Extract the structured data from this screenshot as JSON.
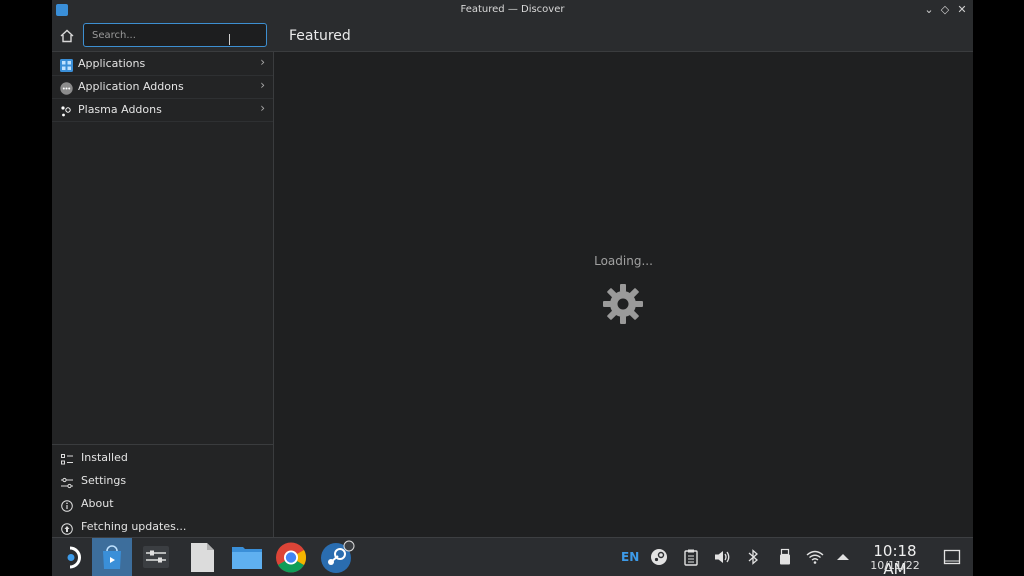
{
  "window": {
    "title": "Featured — Discover",
    "buttons": [
      "minimize",
      "maximize",
      "close"
    ]
  },
  "header": {
    "search_placeholder": "Search...",
    "page_title": "Featured"
  },
  "sidebar": {
    "categories": [
      {
        "label": "Applications",
        "icon": "applications-icon"
      },
      {
        "label": "Application Addons",
        "icon": "addons-icon"
      },
      {
        "label": "Plasma Addons",
        "icon": "plasma-icon"
      }
    ],
    "bottom_items": [
      {
        "label": "Installed",
        "icon": "installed-icon"
      },
      {
        "label": "Settings",
        "icon": "settings-icon"
      },
      {
        "label": "About",
        "icon": "about-icon"
      },
      {
        "label": "Fetching updates...",
        "icon": "updates-icon"
      }
    ]
  },
  "main": {
    "loading_text": "Loading..."
  },
  "taskbar": {
    "apps": [
      "steamos-menu",
      "discover",
      "system-settings",
      "text-file",
      "file-manager",
      "chrome",
      "steam"
    ],
    "language": "EN",
    "time": "10:18 AM",
    "date": "10/11/22"
  },
  "colors": {
    "accent": "#3d8fd1",
    "background": "#1f2021",
    "sidebar": "#232425",
    "taskbar_active": "#3d6e9c"
  }
}
